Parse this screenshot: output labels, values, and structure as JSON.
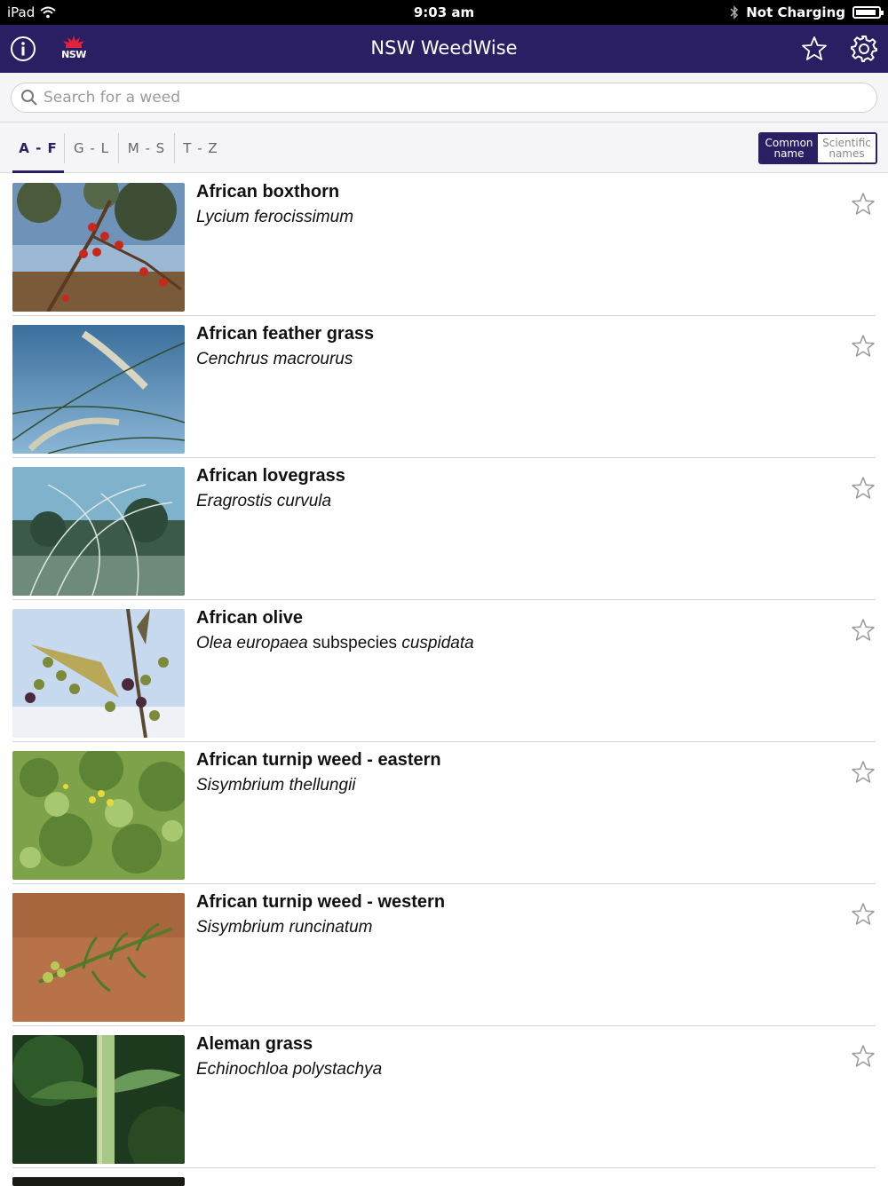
{
  "status_bar": {
    "device": "iPad",
    "time": "9:03 am",
    "charging": "Not Charging"
  },
  "nav": {
    "title": "NSW WeedWise",
    "logo_text": "NSW",
    "info_icon": "info-icon",
    "favorites_icon": "star-icon",
    "settings_icon": "gear-icon"
  },
  "search": {
    "placeholder": "Search for a weed",
    "value": ""
  },
  "tabs": [
    {
      "label": "A - F",
      "active": true
    },
    {
      "label": "G - L",
      "active": false
    },
    {
      "label": "M - S",
      "active": false
    },
    {
      "label": "T - Z",
      "active": false
    }
  ],
  "name_toggle": {
    "common_line1": "Common",
    "common_line2": "name",
    "scientific_line1": "Scientific",
    "scientific_line2": "names",
    "selected": "common"
  },
  "weeds": [
    {
      "common": "African boxthorn",
      "sci_a": "Lycium ferocissimum",
      "sci_mid": "",
      "sci_b": ""
    },
    {
      "common": "African feather grass",
      "sci_a": "Cenchrus macrourus",
      "sci_mid": "",
      "sci_b": ""
    },
    {
      "common": "African lovegrass",
      "sci_a": "Eragrostis curvula",
      "sci_mid": "",
      "sci_b": ""
    },
    {
      "common": "African olive",
      "sci_a": "Olea europaea",
      "sci_mid": " subspecies ",
      "sci_b": "cuspidata"
    },
    {
      "common": "African turnip weed - eastern",
      "sci_a": "Sisymbrium thellungii",
      "sci_mid": "",
      "sci_b": ""
    },
    {
      "common": "African turnip weed - western",
      "sci_a": "Sisymbrium runcinatum",
      "sci_mid": "",
      "sci_b": ""
    },
    {
      "common": "Aleman grass",
      "sci_a": "Echinochloa polystachya",
      "sci_mid": "",
      "sci_b": ""
    }
  ],
  "colors": {
    "nav_bg": "#2a1f62",
    "accent": "#2a1f62"
  }
}
